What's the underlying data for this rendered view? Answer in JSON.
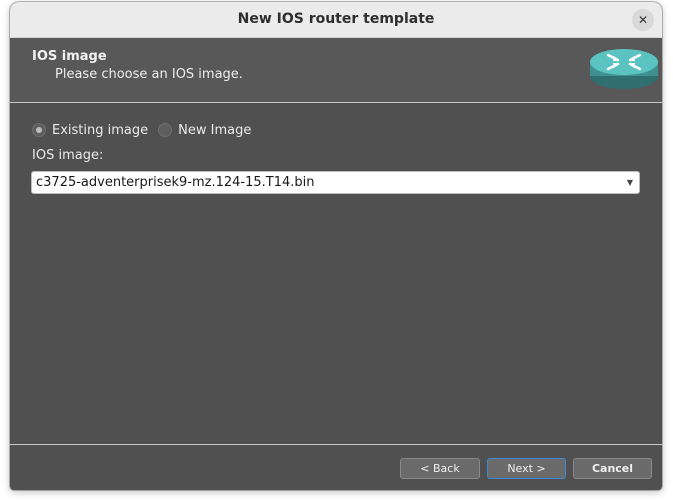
{
  "window": {
    "title": "New IOS router template",
    "close_icon": "close-icon"
  },
  "header": {
    "title": "IOS image",
    "subtitle": "Please choose an IOS image.",
    "icon": "router-icon"
  },
  "image_source": {
    "options": [
      {
        "label": "Existing image",
        "checked": true
      },
      {
        "label": "New Image",
        "checked": false
      }
    ]
  },
  "ios_image": {
    "label": "IOS image:",
    "selected": "c3725-adventerprisek9-mz.124-15.T14.bin"
  },
  "buttons": {
    "back": "< Back",
    "next": "Next >",
    "cancel": "Cancel"
  },
  "colors": {
    "background": "#505050",
    "titlebar": "#ebebeb",
    "router": "#4eb0b0",
    "default_button_border": "#3d8bd6"
  }
}
